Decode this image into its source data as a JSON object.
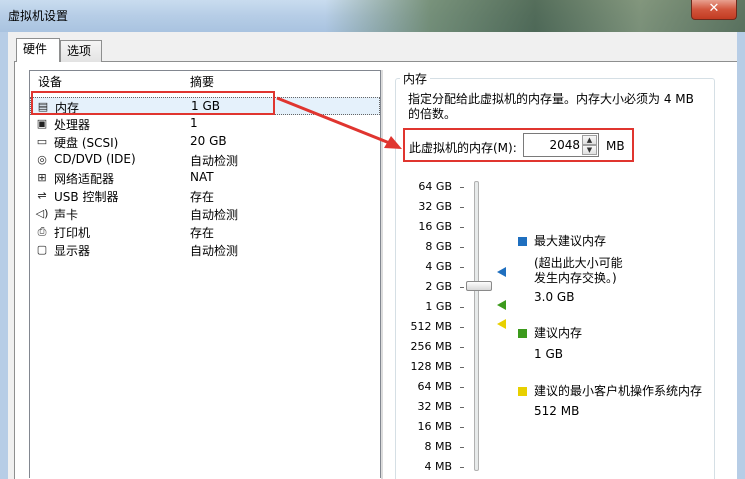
{
  "window": {
    "title": "虚拟机设置",
    "close_glyph": "✕"
  },
  "tabs": [
    {
      "label": "硬件"
    },
    {
      "label": "选项"
    }
  ],
  "device_list": {
    "header_device": "设备",
    "header_summary": "摘要",
    "items": [
      {
        "name": "内存",
        "summary": "1 GB",
        "icon": "memory-icon"
      },
      {
        "name": "处理器",
        "summary": "1",
        "icon": "cpu-icon"
      },
      {
        "name": "硬盘 (SCSI)",
        "summary": "20 GB",
        "icon": "hdd-icon"
      },
      {
        "name": "CD/DVD (IDE)",
        "summary": "自动检测",
        "icon": "cd-icon"
      },
      {
        "name": "网络适配器",
        "summary": "NAT",
        "icon": "network-icon"
      },
      {
        "name": "USB 控制器",
        "summary": "存在",
        "icon": "usb-icon"
      },
      {
        "name": "声卡",
        "summary": "自动检测",
        "icon": "sound-icon"
      },
      {
        "name": "打印机",
        "summary": "存在",
        "icon": "printer-icon"
      },
      {
        "name": "显示器",
        "summary": "自动检测",
        "icon": "monitor-icon"
      }
    ]
  },
  "memory": {
    "group_title": "内存",
    "description": "指定分配给此虚拟机的内存量。内存大小必须为 4 MB 的倍数。",
    "label": "此虚拟机的内存(M):",
    "value": "2048",
    "unit": "MB",
    "scale_labels": [
      "64 GB",
      "32 GB",
      "16 GB",
      "8 GB",
      "4 GB",
      "2 GB",
      "1 GB",
      "512 MB",
      "256 MB",
      "128 MB",
      "64 MB",
      "32 MB",
      "16 MB",
      "8 MB",
      "4 MB"
    ],
    "legend": {
      "max_title": "最大建议内存",
      "max_note_1": "(超出此大小可能",
      "max_note_2": "发生内存交换。)",
      "max_value": "3.0 GB",
      "rec_title": "建议内存",
      "rec_value": "1 GB",
      "min_title": "建议的最小客户机操作系统内存",
      "min_value": "512 MB"
    }
  },
  "colors": {
    "max_marker": "#1f6fbf",
    "rec_marker": "#3c9a1c",
    "min_marker": "#e8d000",
    "annotation": "#e0352f"
  }
}
